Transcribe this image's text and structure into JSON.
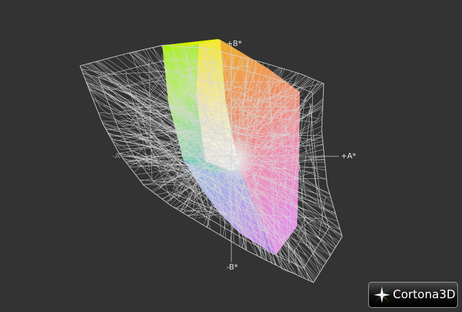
{
  "axes": {
    "plus_b": "+B*",
    "minus_b": "-B*",
    "plus_a": "+A*",
    "minus_a": "-A*"
  },
  "logo": {
    "text": "Cortona3D"
  },
  "colors": {
    "background": "#333333",
    "wireframe": "#d8d8d8",
    "logo_accent": "#35c4c4"
  }
}
